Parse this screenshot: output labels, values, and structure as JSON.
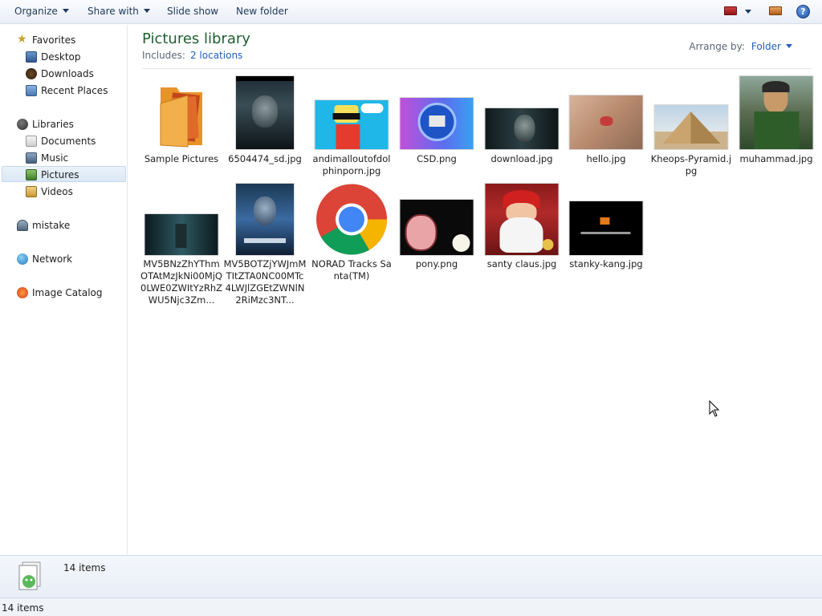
{
  "toolbar": {
    "organize": "Organize",
    "share_with": "Share with",
    "slide_show": "Slide show",
    "new_folder": "New folder",
    "help": "?"
  },
  "nav": {
    "favorites": "Favorites",
    "desktop": "Desktop",
    "downloads": "Downloads",
    "recent_places": "Recent Places",
    "libraries": "Libraries",
    "documents": "Documents",
    "music": "Music",
    "pictures": "Pictures",
    "videos": "Videos",
    "user": "mistake",
    "network": "Network",
    "image_catalog": "Image Catalog",
    "selected": "Pictures"
  },
  "library": {
    "title": "Pictures library",
    "includes_label": "Includes:",
    "includes_link": "2 locations",
    "arrange_label": "Arrange by:",
    "arrange_value": "Folder"
  },
  "items": [
    {
      "label": "Sample Pictures"
    },
    {
      "label": "6504474_sd.jpg"
    },
    {
      "label": "andimalloutofdolphinporn.jpg"
    },
    {
      "label": "CSD.png"
    },
    {
      "label": "download.jpg"
    },
    {
      "label": "hello.jpg"
    },
    {
      "label": "Kheops-Pyramid.jpg"
    },
    {
      "label": "muhammad.jpg"
    },
    {
      "label": "MV5BNzZhYThmOTAtMzJkNi00MjQ0LWE0ZWItYzRhZWU5Njc3Zm..."
    },
    {
      "label": "MV5BOTZjYWJmMTItZTA0NC00MTc4LWJlZGEtZWNlN2RiMzc3NT..."
    },
    {
      "label": "NORAD Tracks Santa(TM)"
    },
    {
      "label": "pony.png"
    },
    {
      "label": "santy claus.jpg"
    },
    {
      "label": "stanky-kang.jpg"
    }
  ],
  "details": {
    "count": "14 items"
  },
  "status": {
    "count": "14 items"
  }
}
